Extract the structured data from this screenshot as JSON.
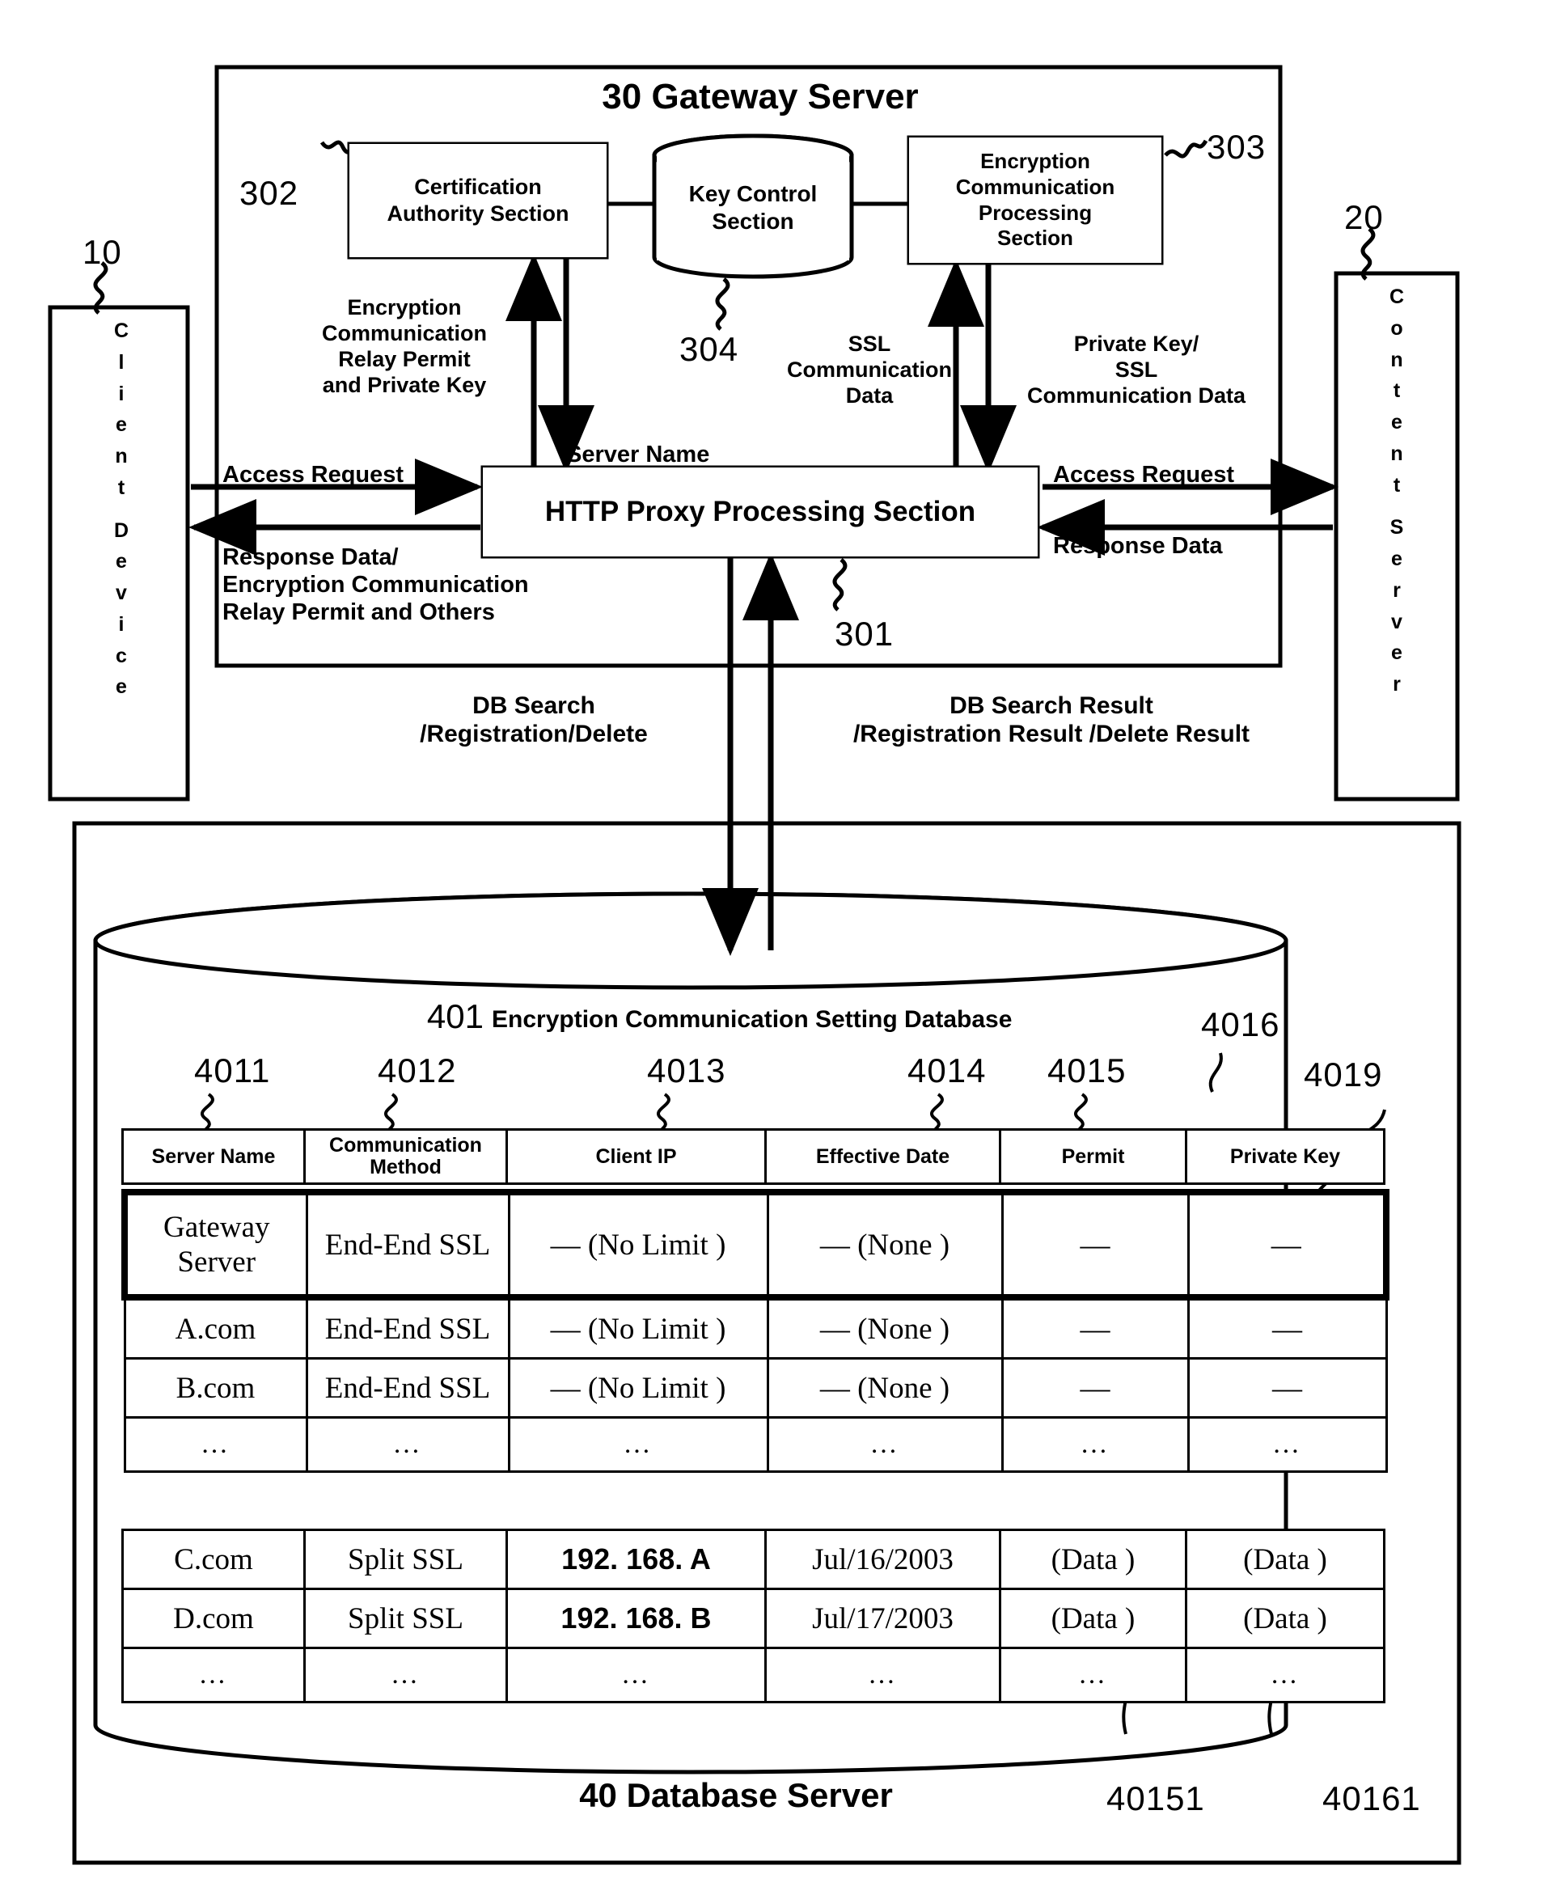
{
  "figure": {
    "gateway_server": {
      "title": "30 Gateway Server",
      "ref": "30",
      "blocks": [
        {
          "ref": "302",
          "label": "Certification\nAuthority Section"
        },
        {
          "ref": "304",
          "label": "Key Control\nSection"
        },
        {
          "ref": "303",
          "label": "Encryption\nCommunication\nProcessing\nSection"
        },
        {
          "ref": "301",
          "label": "HTTP Proxy Processing Section"
        }
      ]
    },
    "client_device": {
      "ref": "10",
      "label": "Client Device",
      "letters": [
        "C",
        "l",
        "i",
        "e",
        "n",
        "t",
        "",
        "D",
        "e",
        "v",
        "i",
        "c",
        "e"
      ]
    },
    "content_server": {
      "ref": "20",
      "label": "Content Server",
      "letters": [
        "C",
        "o",
        "n",
        "t",
        "e",
        "n",
        "t",
        "",
        "S",
        "e",
        "r",
        "v",
        "e",
        "r"
      ]
    },
    "arrow_labels": {
      "enc_relay_permit": "Encryption\nCommunication\nRelay Permit\nand Private Key",
      "server_name": "Server Name",
      "ssl_comm_data": "SSL\nCommunication\nData",
      "private_key_ssl": "Private Key/\nSSL\nCommunication Data",
      "access_request_left": "Access Request",
      "response_data_left": "Response Data/\nEncryption Communication\nRelay Permit and Others",
      "access_request_right": "Access Request",
      "response_data_right": "Response Data",
      "db_search": "DB Search\n/Registration/Delete",
      "db_search_result": "DB Search Result\n/Registration Result /Delete Result"
    },
    "database_server": {
      "title": "40 Database Server",
      "ref": "40",
      "db_title_ref": "401",
      "db_title": "Encryption Communication Setting Database",
      "column_refs": [
        "4011",
        "4012",
        "4013",
        "4014",
        "4015",
        "4016"
      ],
      "extra_refs": {
        "row_ref": "4019",
        "permit_ref": "40151",
        "key_ref": "40161"
      },
      "columns": [
        "Server Name",
        "Communication\nMethod",
        "Client IP",
        "Effective Date",
        "Permit",
        "Private Key"
      ],
      "rows": [
        {
          "highlight": true,
          "cells": [
            "Gateway\nServer",
            "End-End SSL",
            "— (No Limit )",
            "— (None )",
            "—",
            "—"
          ]
        },
        {
          "highlight": false,
          "cells": [
            "A.com",
            "End-End SSL",
            "— (No Limit )",
            "— (None )",
            "—",
            "—"
          ]
        },
        {
          "highlight": false,
          "cells": [
            "B.com",
            "End-End SSL",
            "— (No Limit )",
            "— (None )",
            "—",
            "—"
          ]
        },
        {
          "highlight": false,
          "cells": [
            "…",
            "…",
            "…",
            "…",
            "…",
            "…"
          ]
        }
      ],
      "rows2": [
        {
          "highlight": false,
          "cells": [
            "C.com",
            "Split SSL",
            "192. 168. A",
            "Jul/16/2003",
            "(Data )",
            "(Data )"
          ]
        },
        {
          "highlight": false,
          "cells": [
            "D.com",
            "Split SSL",
            "192. 168. B",
            "Jul/17/2003",
            "(Data )",
            "(Data )"
          ]
        },
        {
          "highlight": false,
          "cells": [
            "…",
            "…",
            "…",
            "…",
            "…",
            "…"
          ]
        }
      ]
    },
    "colors": {
      "ink": "#000000",
      "paper": "#ffffff"
    }
  }
}
